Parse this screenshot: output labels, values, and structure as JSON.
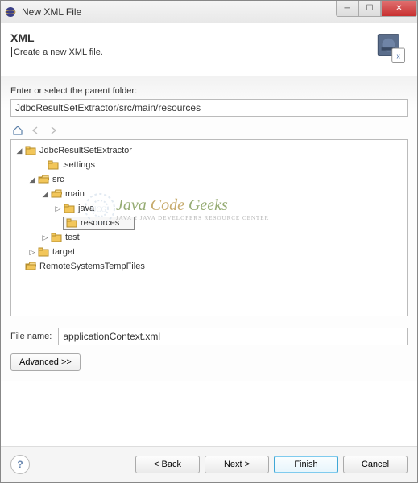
{
  "window": {
    "title": "New XML File"
  },
  "header": {
    "title": "XML",
    "description": "Create a new XML file."
  },
  "parent_folder": {
    "label": "Enter or select the parent folder:",
    "value": "JdbcResultSetExtractor/src/main/resources"
  },
  "tree": {
    "project": "JdbcResultSetExtractor",
    "settings": ".settings",
    "src": "src",
    "main": "main",
    "java": "java",
    "resources": "resources",
    "test": "test",
    "target": "target",
    "remote": "RemoteSystemsTempFiles"
  },
  "filename": {
    "label": "File name:",
    "value": "applicationContext.xml"
  },
  "buttons": {
    "advanced": "Advanced >>",
    "back": "< Back",
    "next": "Next >",
    "finish": "Finish",
    "cancel": "Cancel"
  },
  "watermark": {
    "title_java": "Java ",
    "title_code": "Code ",
    "title_geeks": "Geeks",
    "subtitle": "Java 2 Java Developers Resource Center"
  }
}
